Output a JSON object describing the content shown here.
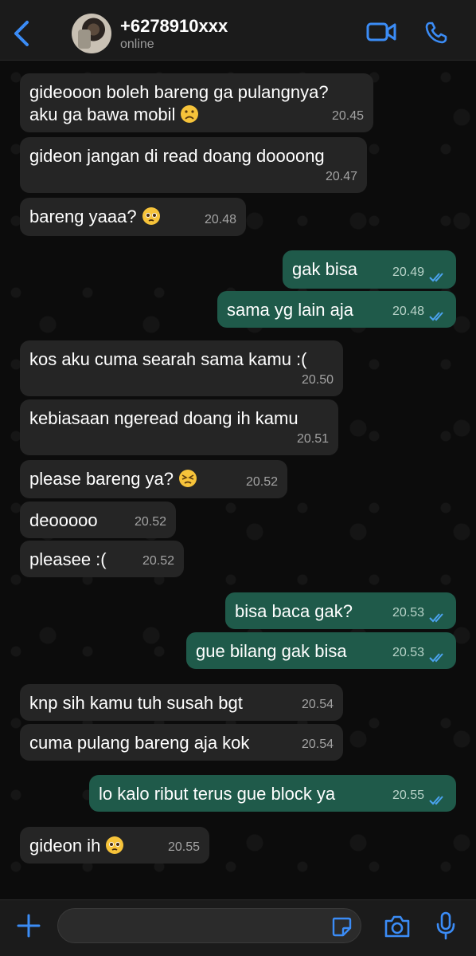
{
  "header": {
    "contact_name": "+6278910xxx",
    "status": "online",
    "accent": "#3b8cf6"
  },
  "messages": [
    {
      "dir": "in",
      "lines": [
        "gideooon boleh bareng ga pulangnya?",
        "aku ga bawa mobil"
      ],
      "emoji": "frowning-face",
      "time": "20.45"
    },
    {
      "dir": "in",
      "lines": [
        "gideon jangan di read doang doooong"
      ],
      "time": "20.47"
    },
    {
      "dir": "in",
      "lines": [
        "bareng yaaa?"
      ],
      "emoji": "pleading-face",
      "time": "20.48"
    },
    {
      "dir": "out",
      "lines": [
        "gak bisa"
      ],
      "time": "20.49",
      "read": true
    },
    {
      "dir": "out",
      "lines": [
        "sama yg lain aja"
      ],
      "time": "20.48",
      "read": true
    },
    {
      "dir": "in",
      "lines": [
        "kos aku cuma searah sama kamu :("
      ],
      "time": "20.50"
    },
    {
      "dir": "in",
      "lines": [
        "kebiasaan ngeread doang ih kamu"
      ],
      "time": "20.51"
    },
    {
      "dir": "in",
      "lines": [
        "please bareng ya?"
      ],
      "emoji": "persevering-face",
      "time": "20.52"
    },
    {
      "dir": "in",
      "lines": [
        "deooooo"
      ],
      "time": "20.52"
    },
    {
      "dir": "in",
      "lines": [
        "pleasee :("
      ],
      "time": "20.52"
    },
    {
      "dir": "out",
      "lines": [
        "bisa baca gak?"
      ],
      "time": "20.53",
      "read": true
    },
    {
      "dir": "out",
      "lines": [
        "gue bilang gak bisa"
      ],
      "time": "20.53",
      "read": true
    },
    {
      "dir": "in",
      "lines": [
        "knp sih kamu tuh susah bgt"
      ],
      "time": "20.54"
    },
    {
      "dir": "in",
      "lines": [
        "cuma pulang bareng aja kok"
      ],
      "time": "20.54"
    },
    {
      "dir": "out",
      "lines": [
        "lo kalo ribut terus gue block ya"
      ],
      "time": "20.55",
      "read": true
    },
    {
      "dir": "in",
      "lines": [
        "gideon ih"
      ],
      "emoji": "pleading-face",
      "time": "20.55"
    }
  ],
  "composer": {
    "placeholder": ""
  }
}
